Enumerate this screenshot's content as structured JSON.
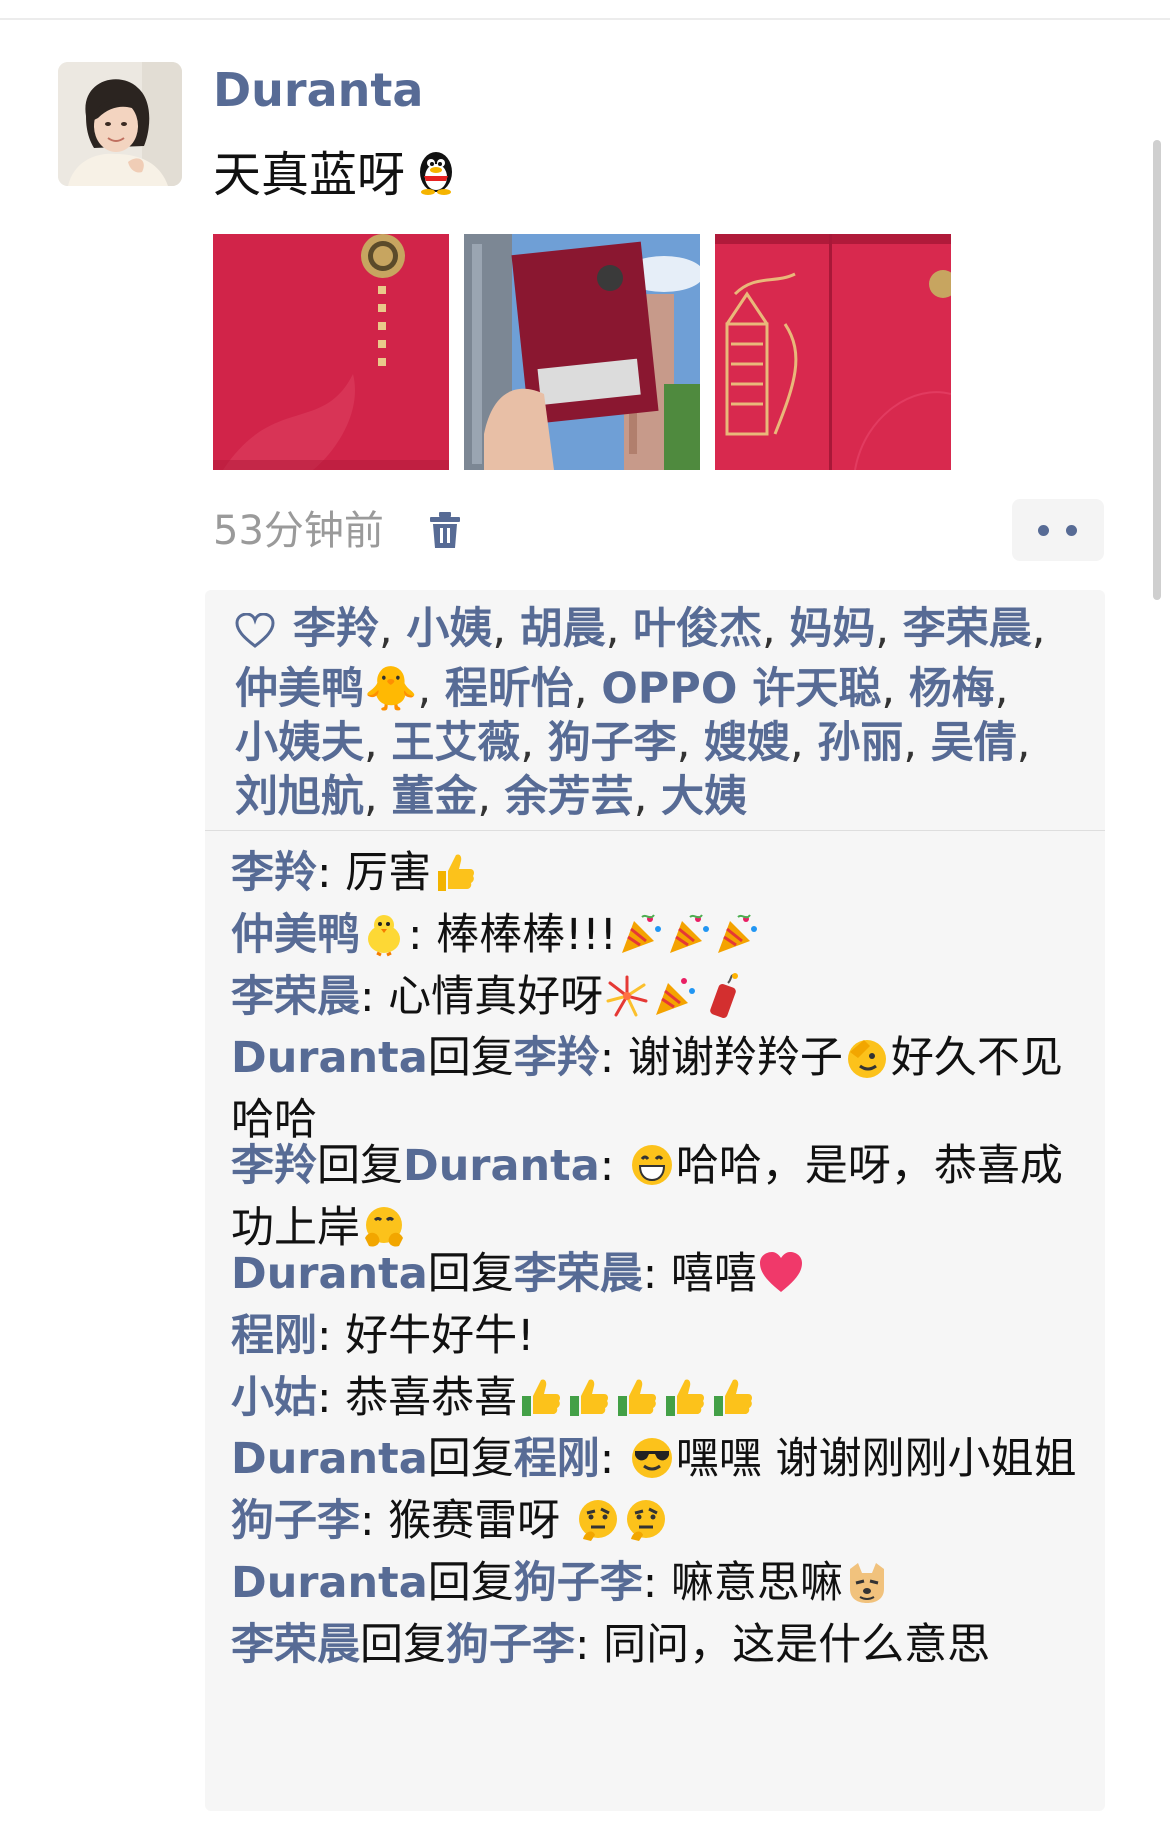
{
  "post": {
    "author": "Duranta",
    "text": "天真蓝呀",
    "time": "53分钟前",
    "photo_count": 3
  },
  "likes": [
    "李羚",
    "小姨",
    "胡晨",
    "叶俊杰",
    "妈妈",
    "李荣晨",
    "仲美鸭🐥",
    "程昕怡",
    "OPPO 许天聪",
    "杨梅",
    "小姨夫",
    "王艾薇",
    "狗子李",
    "嫂嫂",
    "孙丽",
    "吴倩",
    "刘旭航",
    "董金",
    "余芳芸",
    "大姨"
  ],
  "comments": [
    {
      "name": "李羚",
      "text": "厉害"
    },
    {
      "name": "仲美鸭",
      "text": "棒棒棒!!!"
    },
    {
      "name": "李荣晨",
      "text": "心情真好呀"
    },
    {
      "name": "Duranta",
      "reply_word": "回复",
      "reply_to": "李羚",
      "text_a": "谢谢羚羚子",
      "text_b": "好久不见哈哈"
    },
    {
      "name": "李羚",
      "reply_word": "回复",
      "reply_to": "Duranta",
      "text": "哈哈，是呀，恭喜成功上岸"
    },
    {
      "name": "Duranta",
      "reply_word": "回复",
      "reply_to": "李荣晨",
      "text": "嘻嘻"
    },
    {
      "name": "程刚",
      "text": "好牛好牛!"
    },
    {
      "name": "小姑",
      "text": "恭喜恭喜"
    },
    {
      "name": "Duranta",
      "reply_word": "回复",
      "reply_to": "程刚",
      "text": "嘿嘿 谢谢刚刚小姐姐"
    },
    {
      "name": "狗子李",
      "text": "猴赛雷呀 "
    },
    {
      "name": "Duranta",
      "reply_word": "回复",
      "reply_to": "狗子李",
      "text": "嘛意思嘛"
    },
    {
      "name": "李荣晨",
      "reply_word": "回复",
      "reply_to": "狗子李",
      "text": "同问，这是什么意思"
    }
  ],
  "colors": {
    "link": "#576b95",
    "box": "#f6f6f6",
    "photo_red": "#d8294e"
  },
  "icons": [
    "heart-outline-icon",
    "trash-icon",
    "more-dots-icon",
    "penguin-emoji",
    "chick-emoji",
    "thumbs-up-emoji",
    "party-popper-emoji",
    "fireworks-emoji",
    "firecracker-emoji",
    "salute-emoji",
    "grin-emoji",
    "hug-emoji",
    "red-heart-emoji",
    "sunglasses-emoji",
    "thinking-emoji",
    "doge-emoji"
  ]
}
